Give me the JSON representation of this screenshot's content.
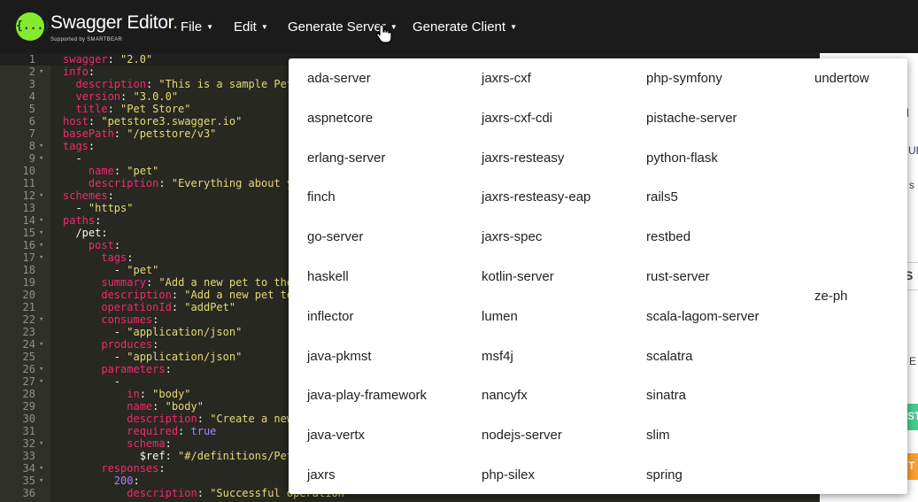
{
  "app": {
    "brand_name": "Swagger Editor",
    "brand_dot": ".",
    "tagline": "Supported by SMARTBEAR",
    "logo_text": "{...}"
  },
  "menu": {
    "file": "File",
    "edit": "Edit",
    "generate_server": "Generate Server",
    "generate_client": "Generate Client",
    "caret": "▼"
  },
  "editor": {
    "lines": [
      {
        "n": "1",
        "fold": "",
        "parts": [
          [
            "k",
            "swagger"
          ],
          [
            "t",
            ": "
          ],
          [
            "s",
            "\"2.0\""
          ]
        ]
      },
      {
        "n": "2",
        "fold": "▾",
        "parts": [
          [
            "k",
            "info"
          ],
          [
            "t",
            ":"
          ]
        ]
      },
      {
        "n": "3",
        "fold": "",
        "parts": [
          [
            "t",
            "  "
          ],
          [
            "k",
            "description"
          ],
          [
            "t",
            ": "
          ],
          [
            "s",
            "\"This is a sample Pet"
          ]
        ]
      },
      {
        "n": "4",
        "fold": "",
        "parts": [
          [
            "t",
            "  "
          ],
          [
            "k",
            "version"
          ],
          [
            "t",
            ": "
          ],
          [
            "s",
            "\"3.0.0\""
          ]
        ]
      },
      {
        "n": "5",
        "fold": "",
        "parts": [
          [
            "t",
            "  "
          ],
          [
            "k",
            "title"
          ],
          [
            "t",
            ": "
          ],
          [
            "s",
            "\"Pet Store\""
          ]
        ]
      },
      {
        "n": "6",
        "fold": "",
        "parts": [
          [
            "k",
            "host"
          ],
          [
            "t",
            ": "
          ],
          [
            "s",
            "\"petstore3.swagger.io\""
          ]
        ]
      },
      {
        "n": "7",
        "fold": "",
        "parts": [
          [
            "k",
            "basePath"
          ],
          [
            "t",
            ": "
          ],
          [
            "s",
            "\"/petstore/v3\""
          ]
        ]
      },
      {
        "n": "8",
        "fold": "▾",
        "parts": [
          [
            "k",
            "tags"
          ],
          [
            "t",
            ":"
          ]
        ]
      },
      {
        "n": "9",
        "fold": "▾",
        "parts": [
          [
            "t",
            "  -"
          ]
        ]
      },
      {
        "n": "10",
        "fold": "",
        "parts": [
          [
            "t",
            "    "
          ],
          [
            "k",
            "name"
          ],
          [
            "t",
            ": "
          ],
          [
            "s",
            "\"pet\""
          ]
        ]
      },
      {
        "n": "11",
        "fold": "",
        "parts": [
          [
            "t",
            "    "
          ],
          [
            "k",
            "description"
          ],
          [
            "t",
            ": "
          ],
          [
            "s",
            "\"Everything about yo"
          ]
        ]
      },
      {
        "n": "12",
        "fold": "▾",
        "parts": [
          [
            "k",
            "schemes"
          ],
          [
            "t",
            ":"
          ]
        ]
      },
      {
        "n": "13",
        "fold": "",
        "parts": [
          [
            "t",
            "  - "
          ],
          [
            "s",
            "\"https\""
          ]
        ]
      },
      {
        "n": "14",
        "fold": "▾",
        "parts": [
          [
            "k",
            "paths"
          ],
          [
            "t",
            ":"
          ]
        ]
      },
      {
        "n": "15",
        "fold": "▾",
        "parts": [
          [
            "t",
            "  /pet:"
          ]
        ]
      },
      {
        "n": "16",
        "fold": "▾",
        "parts": [
          [
            "t",
            "    "
          ],
          [
            "k",
            "post"
          ],
          [
            "t",
            ":"
          ]
        ]
      },
      {
        "n": "17",
        "fold": "▾",
        "parts": [
          [
            "t",
            "      "
          ],
          [
            "k",
            "tags"
          ],
          [
            "t",
            ":"
          ]
        ]
      },
      {
        "n": "18",
        "fold": "",
        "parts": [
          [
            "t",
            "        - "
          ],
          [
            "s",
            "\"pet\""
          ]
        ]
      },
      {
        "n": "19",
        "fold": "",
        "parts": [
          [
            "t",
            "      "
          ],
          [
            "k",
            "summary"
          ],
          [
            "t",
            ": "
          ],
          [
            "s",
            "\"Add a new pet to the"
          ]
        ]
      },
      {
        "n": "20",
        "fold": "",
        "parts": [
          [
            "t",
            "      "
          ],
          [
            "k",
            "description"
          ],
          [
            "t",
            ": "
          ],
          [
            "s",
            "\"Add a new pet to"
          ]
        ]
      },
      {
        "n": "21",
        "fold": "",
        "parts": [
          [
            "t",
            "      "
          ],
          [
            "k",
            "operationId"
          ],
          [
            "t",
            ": "
          ],
          [
            "s",
            "\"addPet\""
          ]
        ]
      },
      {
        "n": "22",
        "fold": "▾",
        "parts": [
          [
            "t",
            "      "
          ],
          [
            "k",
            "consumes"
          ],
          [
            "t",
            ":"
          ]
        ]
      },
      {
        "n": "23",
        "fold": "",
        "parts": [
          [
            "t",
            "        - "
          ],
          [
            "s",
            "\"application/json\""
          ]
        ]
      },
      {
        "n": "24",
        "fold": "▾",
        "parts": [
          [
            "t",
            "      "
          ],
          [
            "k",
            "produces"
          ],
          [
            "t",
            ":"
          ]
        ]
      },
      {
        "n": "25",
        "fold": "",
        "parts": [
          [
            "t",
            "        - "
          ],
          [
            "s",
            "\"application/json\""
          ]
        ]
      },
      {
        "n": "26",
        "fold": "▾",
        "parts": [
          [
            "t",
            "      "
          ],
          [
            "k",
            "parameters"
          ],
          [
            "t",
            ":"
          ]
        ]
      },
      {
        "n": "27",
        "fold": "▾",
        "parts": [
          [
            "t",
            "        -"
          ]
        ]
      },
      {
        "n": "28",
        "fold": "",
        "parts": [
          [
            "t",
            "          "
          ],
          [
            "k",
            "in"
          ],
          [
            "t",
            ": "
          ],
          [
            "s",
            "\"body\""
          ]
        ]
      },
      {
        "n": "29",
        "fold": "",
        "parts": [
          [
            "t",
            "          "
          ],
          [
            "k",
            "name"
          ],
          [
            "t",
            ": "
          ],
          [
            "s",
            "\"body\""
          ]
        ]
      },
      {
        "n": "30",
        "fold": "",
        "parts": [
          [
            "t",
            "          "
          ],
          [
            "k",
            "description"
          ],
          [
            "t",
            ": "
          ],
          [
            "s",
            "\"Create a new"
          ]
        ]
      },
      {
        "n": "31",
        "fold": "",
        "parts": [
          [
            "t",
            "          "
          ],
          [
            "k",
            "required"
          ],
          [
            "t",
            ": "
          ],
          [
            "b",
            "true"
          ]
        ]
      },
      {
        "n": "32",
        "fold": "▾",
        "parts": [
          [
            "t",
            "          "
          ],
          [
            "k",
            "schema"
          ],
          [
            "t",
            ":"
          ]
        ]
      },
      {
        "n": "33",
        "fold": "",
        "parts": [
          [
            "t",
            "            $ref: "
          ],
          [
            "s",
            "\"#/definitions/Pet"
          ]
        ]
      },
      {
        "n": "34",
        "fold": "▾",
        "parts": [
          [
            "t",
            "      "
          ],
          [
            "k",
            "responses"
          ],
          [
            "t",
            ":"
          ]
        ]
      },
      {
        "n": "35",
        "fold": "▾",
        "parts": [
          [
            "t",
            "        "
          ],
          [
            "b",
            "200"
          ],
          [
            "t",
            ":"
          ]
        ]
      },
      {
        "n": "36",
        "fold": "",
        "parts": [
          [
            "t",
            "          "
          ],
          [
            "k",
            "description"
          ],
          [
            "t",
            ": "
          ],
          [
            "s",
            "\"Successful operation"
          ]
        ]
      }
    ]
  },
  "right_panel": {
    "fragments": [
      "l",
      "UR",
      "s",
      "S",
      "E",
      "ST",
      "T"
    ]
  },
  "dropdown": {
    "columns": [
      [
        "ada-server",
        "aspnetcore",
        "erlang-server",
        "finch",
        "go-server",
        "haskell",
        "inflector",
        "java-pkmst",
        "java-play-framework",
        "java-vertx",
        "jaxrs"
      ],
      [
        "jaxrs-cxf",
        "jaxrs-cxf-cdi",
        "jaxrs-resteasy",
        "jaxrs-resteasy-eap",
        "jaxrs-spec",
        "kotlin-server",
        "lumen",
        "msf4j",
        "nancyfx",
        "nodejs-server",
        "php-silex"
      ],
      [
        "php-symfony",
        "pistache-server",
        "python-flask",
        "rails5",
        "restbed",
        "rust-server",
        "scala-lagom-server",
        "scalatra",
        "sinatra",
        "slim",
        "spring"
      ],
      [
        "undertow",
        "ze-ph"
      ]
    ]
  }
}
